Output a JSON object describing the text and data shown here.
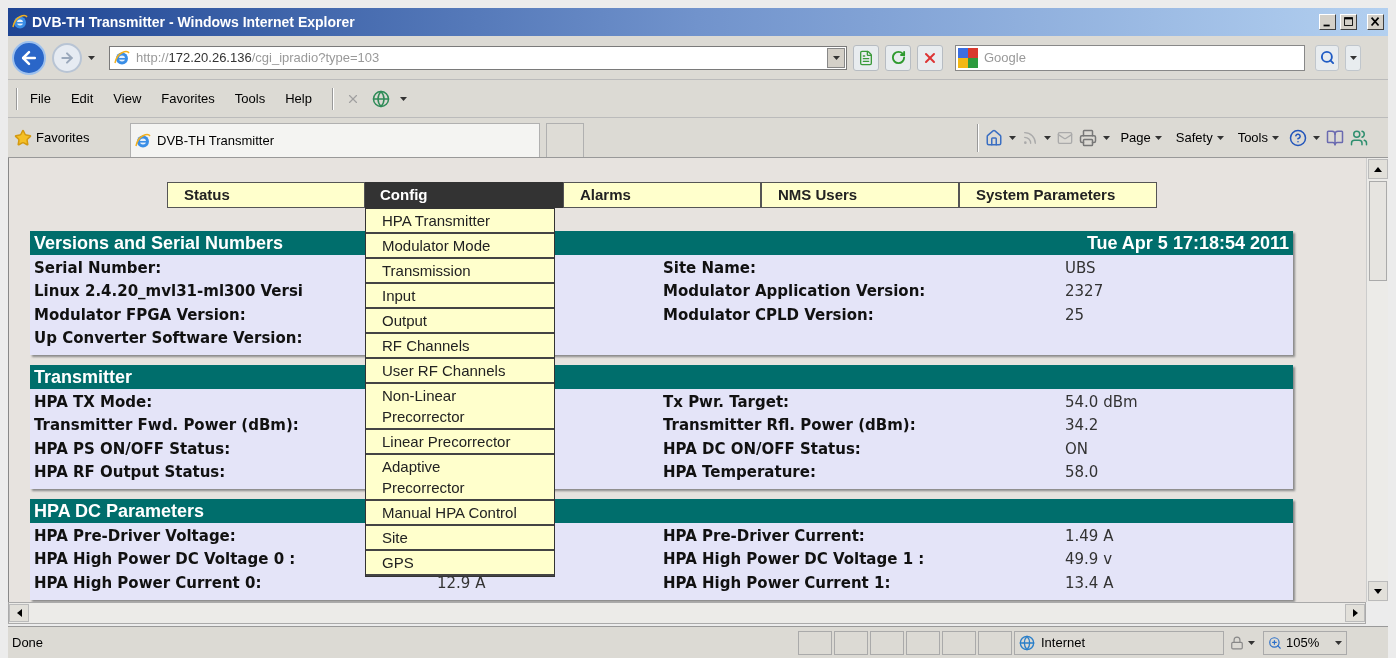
{
  "window": {
    "title": "DVB-TH Transmitter - Windows Internet Explorer"
  },
  "address_bar": {
    "url": "http://**172.20.26.136**/cgi_ipradio?type=103"
  },
  "search": {
    "placeholder": "Google"
  },
  "menu": [
    "File",
    "Edit",
    "View",
    "Favorites",
    "Tools",
    "Help"
  ],
  "favorites_bar": {
    "label": "Favorites",
    "tab": "DVB-TH Transmitter"
  },
  "command_bar": [
    "Page",
    "Safety",
    "Tools"
  ],
  "nav_tabs": [
    {
      "label": "Status",
      "selected": false
    },
    {
      "label": "Config",
      "selected": true
    },
    {
      "label": "Alarms",
      "selected": false
    },
    {
      "label": "NMS Users",
      "selected": false
    },
    {
      "label": "System Parameters",
      "selected": false
    }
  ],
  "config_menu": [
    "HPA Transmitter",
    "Modulator Mode",
    "Transmission",
    "Input",
    "Output",
    "RF Channels",
    "User RF Channels",
    "Non-Linear\nPrecorrector",
    "Linear Precorrector",
    "Adaptive\nPrecorrector",
    "Manual HPA Control",
    "Site",
    "GPS"
  ],
  "panels": [
    {
      "title": "Versions and Serial Numbers",
      "date": "Tue Apr 5 17:18:54 2011",
      "rows": [
        {
          "label": "Serial Number:",
          "label_2": "Site Name:",
          "value_2": "UBS"
        },
        {
          "label": "Linux 2.4.20_mvl31-ml300 Versi",
          "label_2": "Modulator Application Version:",
          "value_2": "2327"
        },
        {
          "label": "Modulator FPGA Version:",
          "label_2": "Modulator CPLD Version:",
          "value_2": "25"
        },
        {
          "label": "Up Converter Software Version:"
        }
      ]
    },
    {
      "title": "Transmitter",
      "rows": [
        {
          "label": "HPA TX Mode:",
          "label_2": "Tx Pwr. Target:",
          "value_2": "54.0 dBm"
        },
        {
          "label": "Transmitter Fwd. Power (dBm):",
          "label_2": "Transmitter Rfl. Power (dBm):",
          "value_2": "34.2"
        },
        {
          "label": "HPA PS ON/OFF Status:",
          "label_2": "HPA DC ON/OFF Status:",
          "value_2": "ON"
        },
        {
          "label": "HPA RF Output Status:",
          "label_2": "HPA Temperature:",
          "value_2": "58.0"
        }
      ]
    },
    {
      "title": "HPA DC Parameters",
      "rows": [
        {
          "label": "HPA Pre-Driver Voltage:",
          "label_2": "HPA Pre-Driver Current:",
          "value_2": "1.49 A"
        },
        {
          "label": "HPA High Power DC Voltage 0 :",
          "label_2": "HPA High Power DC Voltage 1 :",
          "value_2": "49.9 v"
        },
        {
          "label": "HPA High Power Current 0:",
          "value": "12.9 A",
          "label_2": "HPA High Power Current 1:",
          "value_2": "13.4 A"
        }
      ]
    }
  ],
  "status_bar": {
    "text": "Done",
    "zone": "Internet",
    "zoom": "105%"
  }
}
